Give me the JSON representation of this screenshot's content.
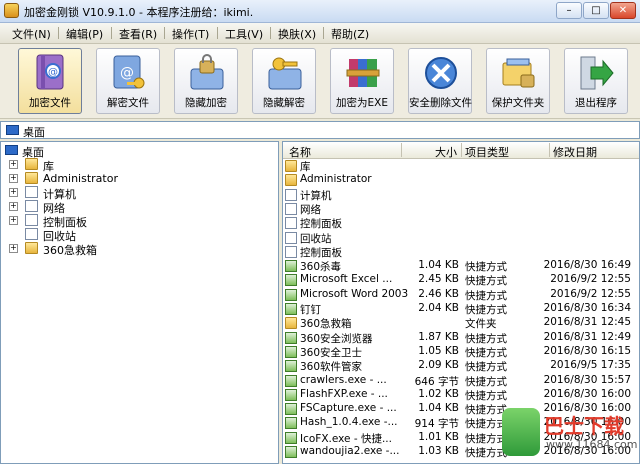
{
  "window": {
    "title": "加密金刚锁 V10.9.1.0 - 本程序注册给：ikimi.",
    "min": "–",
    "max": "□",
    "close": "✕"
  },
  "menu": [
    "文件(N)",
    "编辑(P)",
    "查看(R)",
    "操作(T)",
    "工具(V)",
    "换肤(X)",
    "帮助(Z)"
  ],
  "toolbar": [
    {
      "label": "加密文件",
      "icon": "encrypt-book-icon"
    },
    {
      "label": "解密文件",
      "icon": "decrypt-key-icon"
    },
    {
      "label": "隐藏加密",
      "icon": "lock-drive-icon"
    },
    {
      "label": "隐藏解密",
      "icon": "key-drive-icon"
    },
    {
      "label": "加密为EXE",
      "icon": "archive-icon"
    },
    {
      "label": "安全删除文件",
      "icon": "delete-x-icon"
    },
    {
      "label": "保护文件夹",
      "icon": "protect-folder-icon"
    },
    {
      "label": "退出程序",
      "icon": "exit-arrow-icon"
    }
  ],
  "address": {
    "value": "桌面"
  },
  "tree": {
    "root": "桌面",
    "items": [
      "库",
      "Administrator",
      "计算机",
      "网络",
      "控制面板",
      "回收站",
      "360急救箱"
    ]
  },
  "columns": {
    "name": "名称",
    "size": "大小",
    "type": "项目类型",
    "date": "修改日期"
  },
  "files": [
    {
      "name": "库",
      "size": "",
      "type": "",
      "date": "",
      "icon": "folder"
    },
    {
      "name": "Administrator",
      "size": "",
      "type": "",
      "date": "",
      "icon": "folder"
    },
    {
      "name": "计算机",
      "size": "",
      "type": "",
      "date": "",
      "icon": "doc"
    },
    {
      "name": "网络",
      "size": "",
      "type": "",
      "date": "",
      "icon": "doc"
    },
    {
      "name": "控制面板",
      "size": "",
      "type": "",
      "date": "",
      "icon": "doc"
    },
    {
      "name": "回收站",
      "size": "",
      "type": "",
      "date": "",
      "icon": "doc"
    },
    {
      "name": "控制面板",
      "size": "",
      "type": "",
      "date": "",
      "icon": "doc"
    },
    {
      "name": "360杀毒",
      "size": "1.04 KB",
      "type": "快捷方式",
      "date": "2016/8/30 16:49",
      "icon": "shortcut"
    },
    {
      "name": "Microsoft Excel ...",
      "size": "2.45 KB",
      "type": "快捷方式",
      "date": "2016/9/2 12:55",
      "icon": "shortcut"
    },
    {
      "name": "Microsoft Word 2003",
      "size": "2.46 KB",
      "type": "快捷方式",
      "date": "2016/9/2 12:55",
      "icon": "shortcut"
    },
    {
      "name": "钉钉",
      "size": "2.04 KB",
      "type": "快捷方式",
      "date": "2016/8/30 16:34",
      "icon": "shortcut"
    },
    {
      "name": "360急救箱",
      "size": "",
      "type": "文件夹",
      "date": "2016/8/31 12:45",
      "icon": "folder"
    },
    {
      "name": "360安全浏览器",
      "size": "1.87 KB",
      "type": "快捷方式",
      "date": "2016/8/31 12:49",
      "icon": "shortcut"
    },
    {
      "name": "360安全卫士",
      "size": "1.05 KB",
      "type": "快捷方式",
      "date": "2016/8/30 16:15",
      "icon": "shortcut"
    },
    {
      "name": "360软件管家",
      "size": "2.09 KB",
      "type": "快捷方式",
      "date": "2016/9/5 17:35",
      "icon": "shortcut"
    },
    {
      "name": "crawlers.exe - ...",
      "size": "646 字节",
      "type": "快捷方式",
      "date": "2016/8/30 15:57",
      "icon": "shortcut"
    },
    {
      "name": "FlashFXP.exe - ...",
      "size": "1.02 KB",
      "type": "快捷方式",
      "date": "2016/8/30 16:00",
      "icon": "shortcut"
    },
    {
      "name": "FSCapture.exe - ...",
      "size": "1.04 KB",
      "type": "快捷方式",
      "date": "2016/8/30 16:00",
      "icon": "shortcut"
    },
    {
      "name": "Hash_1.0.4.exe -...",
      "size": "914 字节",
      "type": "快捷方式",
      "date": "2016/8/30 16:00",
      "icon": "shortcut"
    },
    {
      "name": "IcoFX.exe - 快捷...",
      "size": "1.01 KB",
      "type": "快捷方式",
      "date": "2016/8/30 16:00",
      "icon": "shortcut"
    },
    {
      "name": "wandoujia2.exe -...",
      "size": "1.03 KB",
      "type": "快捷方式",
      "date": "2016/8/30 16:00",
      "icon": "shortcut"
    }
  ],
  "watermark": {
    "title": "巴士下载",
    "url": "www.11684.com"
  }
}
